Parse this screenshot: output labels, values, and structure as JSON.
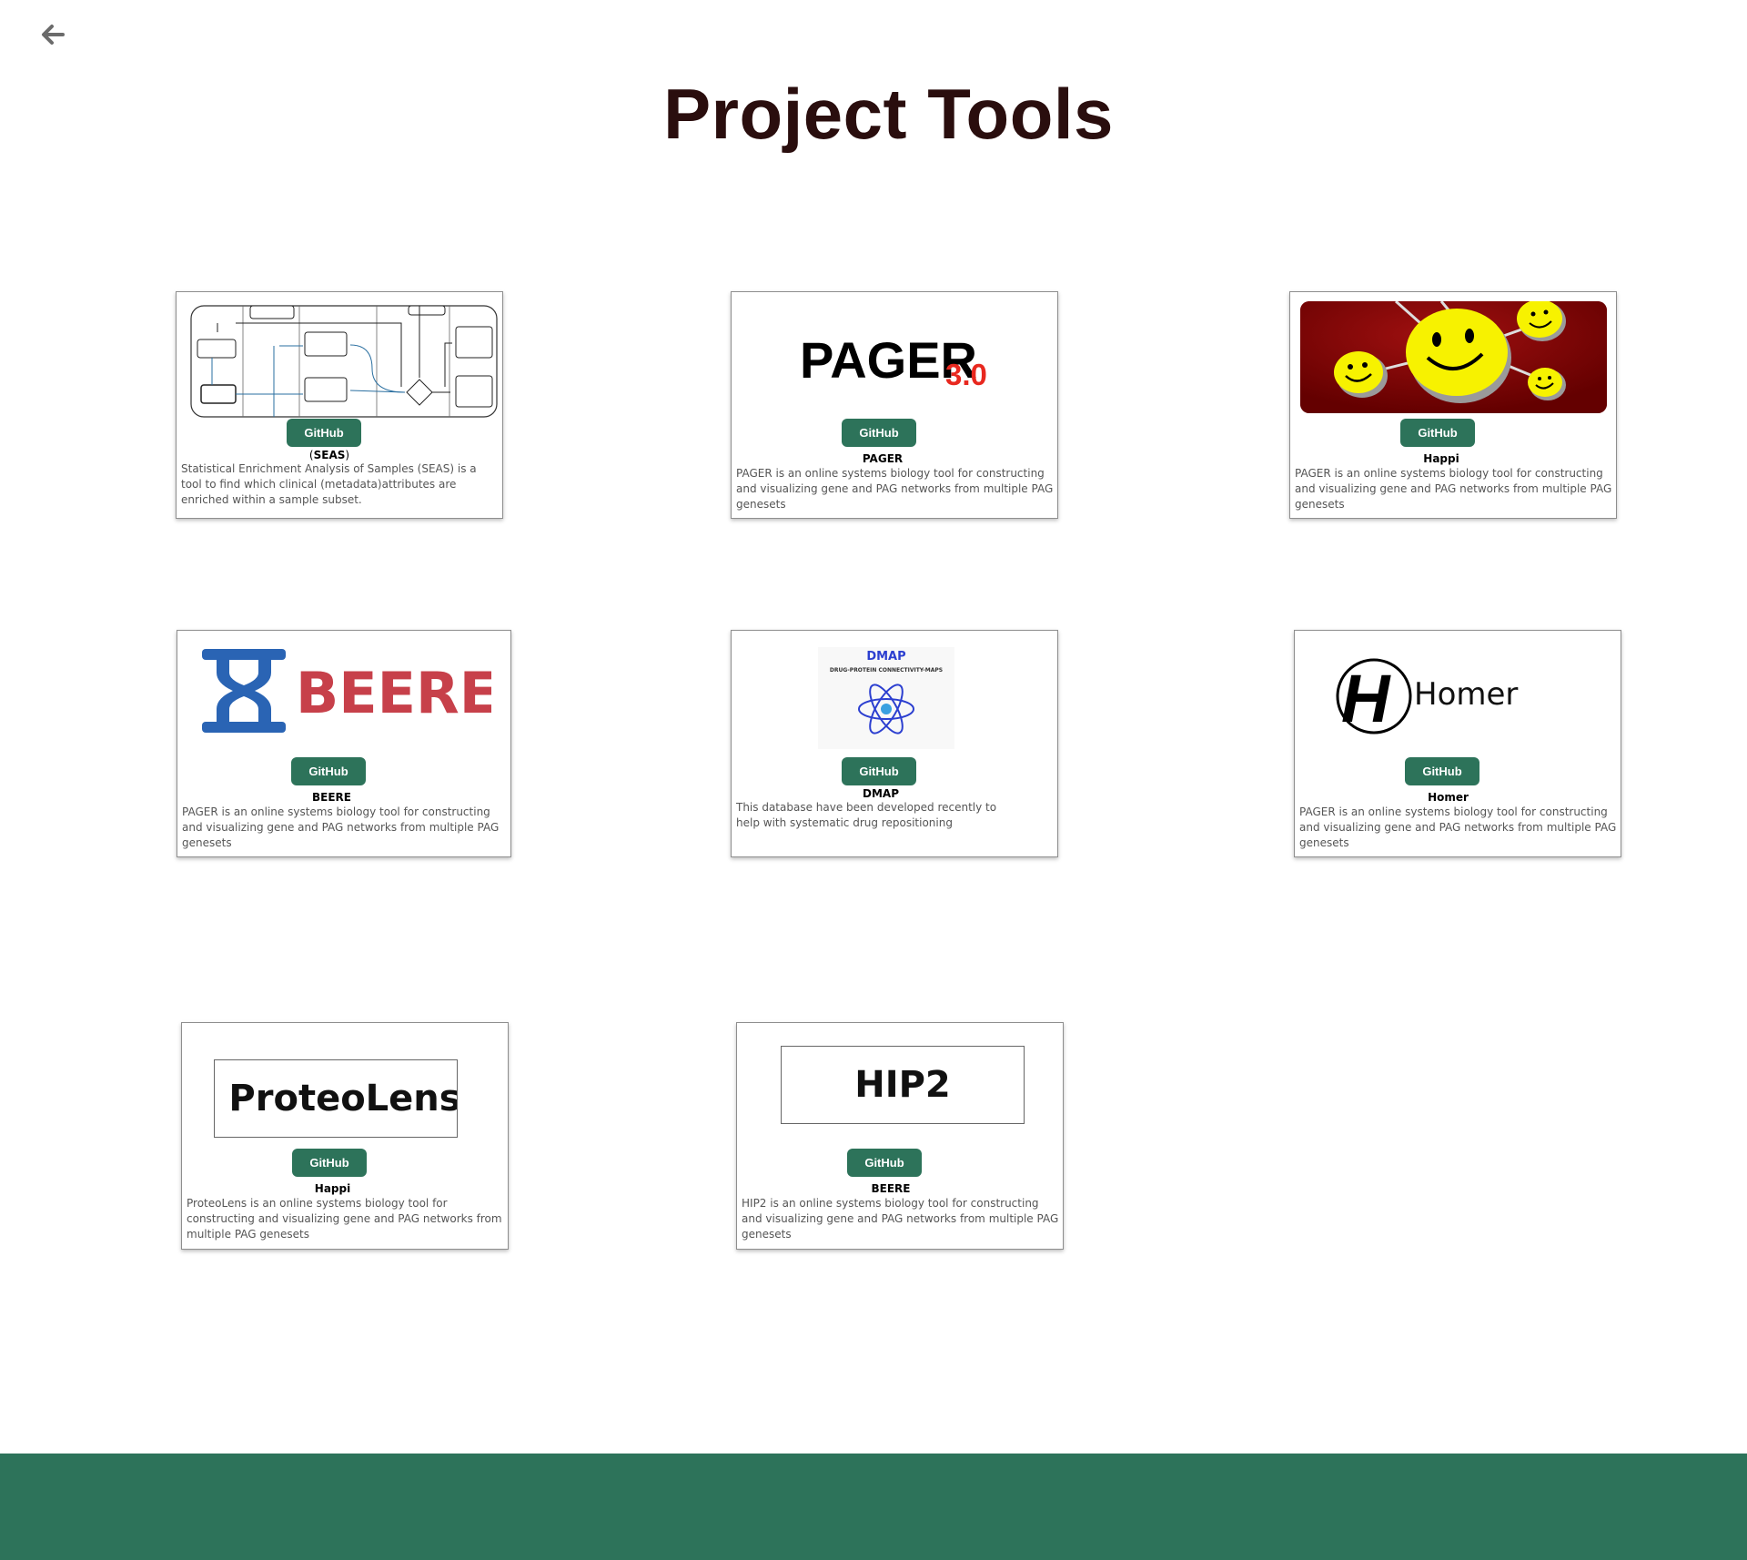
{
  "nav": {
    "back_icon": "arrow-left-icon"
  },
  "header": {
    "title": "Project Tools"
  },
  "colors": {
    "accent": "#2d735a",
    "title": "#2a0e0e",
    "footer": "#2d735a",
    "pager_red": "#e8281f",
    "beere_red": "#c7404a",
    "beere_blue": "#2a64b4",
    "dmap_blue": "#2c3fd0",
    "happi_bg": "#7a0000",
    "happi_yellow": "#f7f200"
  },
  "cards": [
    {
      "logo": "seas-workflow-diagram",
      "button": "GitHub",
      "name_prefix": "(",
      "name": "SEAS",
      "name_suffix": ")",
      "description": "Statistical Enrichment Analysis of Samples (SEAS) is a tool to find which clinical (metadata)attributes are enriched within a sample subset."
    },
    {
      "logo": "pager-logo",
      "logo_text": "PAGER",
      "logo_version": "3.0",
      "button": "GitHub",
      "name": "PAGER",
      "description": "PAGER is an online systems biology tool for constructing and visualizing gene and PAG networks from multiple PAG genesets"
    },
    {
      "logo": "happi-smiley-network",
      "button": "GitHub",
      "name": "Happi",
      "description": "PAGER is an online systems biology tool for constructing and visualizing gene and PAG networks from multiple PAG genesets"
    },
    {
      "logo": "beere-hourglass-logo",
      "logo_text": "BEERE",
      "button": "GitHub",
      "name": "BEERE",
      "description": "PAGER is an online systems biology tool for constructing and visualizing gene and PAG networks from multiple PAG genesets"
    },
    {
      "logo": "dmap-atom-logo",
      "logo_text": "DMAP",
      "logo_subtitle": "DRUG-PROTEIN CONNECTIVITY-MAPS",
      "button": "GitHub",
      "name": "DMAP",
      "description": "This database have been developed recently to help with systematic drug repositioning"
    },
    {
      "logo": "homer-h-logo",
      "logo_letter": "H",
      "logo_text": "Homer",
      "button": "GitHub",
      "name": "Homer",
      "description": "PAGER is an online systems biology tool for constructing and visualizing gene and PAG networks from multiple PAG genesets"
    },
    {
      "logo": "proteolens-text-logo",
      "logo_text": "ProteoLens",
      "button": "GitHub",
      "name": "Happi",
      "description": "ProteoLens is an online systems biology tool for constructing and visualizing gene and PAG networks from multiple PAG genesets"
    },
    {
      "logo": "hip2-text-logo",
      "logo_text": "HIP2",
      "button": "GitHub",
      "name": "BEERE",
      "description": "HIP2 is an online systems biology tool for constructing and visualizing gene and PAG networks from multiple PAG genesets"
    }
  ]
}
